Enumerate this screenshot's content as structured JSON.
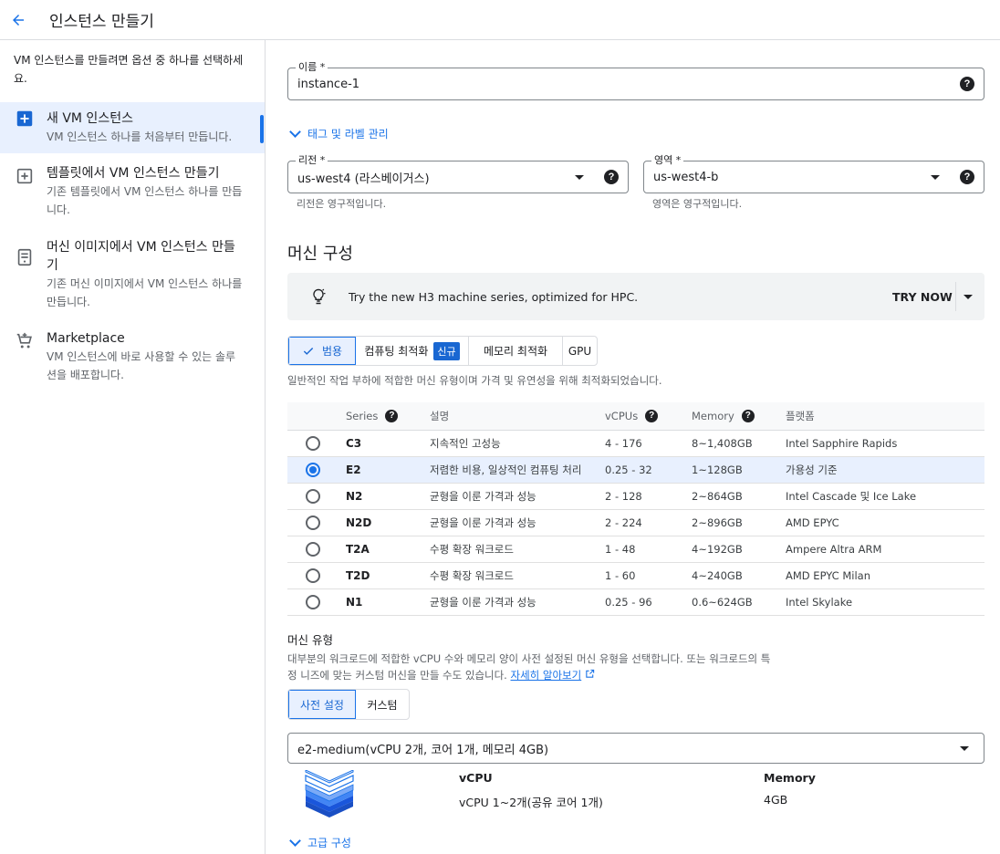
{
  "header": {
    "title": "인스턴스 만들기",
    "back_icon": "arrow-left-icon"
  },
  "colors": {
    "accent": "#1a73e8",
    "selected_bg": "#e8f0fe",
    "banner_bg": "#f1f3f4"
  },
  "sidebar": {
    "intro": "VM 인스턴스를 만들려면 옵션 중 하나를 선택하세요.",
    "items": [
      {
        "title": "새 VM 인스턴스",
        "desc": "VM 인스턴스 하나를 처음부터 만듭니다.",
        "icon": "add-box-icon",
        "active": true
      },
      {
        "title": "템플릿에서 VM 인스턴스 만들기",
        "desc": "기존 템플릿에서 VM 인스턴스 하나를 만듭니다.",
        "icon": "template-add-icon",
        "active": false
      },
      {
        "title": "머신 이미지에서 VM 인스턴스 만들기",
        "desc": "기존 머신 이미지에서 VM 인스턴스 하나를 만듭니다.",
        "icon": "machine-image-icon",
        "active": false
      },
      {
        "title": "Marketplace",
        "desc": "VM 인스턴스에 바로 사용할 수 있는 솔루션을 배포합니다.",
        "icon": "marketplace-cart-icon",
        "active": false
      }
    ]
  },
  "form": {
    "name": {
      "label": "이름 *",
      "value": "instance-1"
    },
    "tags_toggle": "태그 및 라벨 관리",
    "region": {
      "label": "리전 *",
      "value": "us-west4 (라스베이거스)",
      "hint": "리전은 영구적입니다."
    },
    "zone": {
      "label": "영역 *",
      "value": "us-west4-b",
      "hint": "영역은 영구적입니다."
    }
  },
  "machine_config": {
    "title": "머신 구성",
    "banner": {
      "text": "Try the new H3 machine series, optimized for HPC.",
      "button": "TRY NOW"
    },
    "tabs": [
      {
        "label": "범용",
        "selected": true
      },
      {
        "label": "컴퓨팅 최적화",
        "badge": "신규"
      },
      {
        "label": "메모리 최적화"
      },
      {
        "label": "GPU"
      }
    ],
    "tab_desc": "일반적인 작업 부하에 적합한 머신 유형이며 가격 및 유연성을 위해 최적화되었습니다.",
    "table": {
      "headers": [
        "Series",
        "설명",
        "vCPUs",
        "Memory",
        "플랫폼"
      ],
      "rows": [
        {
          "series": "C3",
          "desc": "지속적인 고성능",
          "vcpus": "4 - 176",
          "memory": "8~1,408GB",
          "platform": "Intel Sapphire Rapids",
          "selected": false
        },
        {
          "series": "E2",
          "desc": "저렴한 비용, 일상적인 컴퓨팅 처리",
          "vcpus": "0.25 - 32",
          "memory": "1~128GB",
          "platform": "가용성 기준",
          "selected": true
        },
        {
          "series": "N2",
          "desc": "균형을 이룬 가격과 성능",
          "vcpus": "2 - 128",
          "memory": "2~864GB",
          "platform": "Intel Cascade 및 Ice Lake",
          "selected": false
        },
        {
          "series": "N2D",
          "desc": "균형을 이룬 가격과 성능",
          "vcpus": "2 - 224",
          "memory": "2~896GB",
          "platform": "AMD EPYC",
          "selected": false
        },
        {
          "series": "T2A",
          "desc": "수평 확장 워크로드",
          "vcpus": "1 - 48",
          "memory": "4~192GB",
          "platform": "Ampere Altra ARM",
          "selected": false
        },
        {
          "series": "T2D",
          "desc": "수평 확장 워크로드",
          "vcpus": "1 - 60",
          "memory": "4~240GB",
          "platform": "AMD EPYC Milan",
          "selected": false
        },
        {
          "series": "N1",
          "desc": "균형을 이룬 가격과 성능",
          "vcpus": "0.25 - 96",
          "memory": "0.6~624GB",
          "platform": "Intel Skylake",
          "selected": false
        }
      ]
    },
    "machine_type": {
      "title": "머신 유형",
      "desc_line1": "대부분의 워크로드에 적합한 vCPU 수와 메모리 양이 사전 설정된 머신 유형을 선택합니다. 또는 워크로드의 특",
      "desc_line2": "정 니즈에 맞는 커스텀 머신을 만들 수도 있습니다.",
      "learn_more": "자세히 알아보기",
      "tabs": [
        "사전 설정",
        "커스텀"
      ],
      "selected_value": "e2-medium(vCPU 2개, 코어 1개, 메모리 4GB)",
      "vcpu_label": "vCPU",
      "vcpu_value": "vCPU 1~2개(공유 코어 1개)",
      "memory_label": "Memory",
      "memory_value": "4GB"
    },
    "advanced_toggle": "고급 구성"
  }
}
